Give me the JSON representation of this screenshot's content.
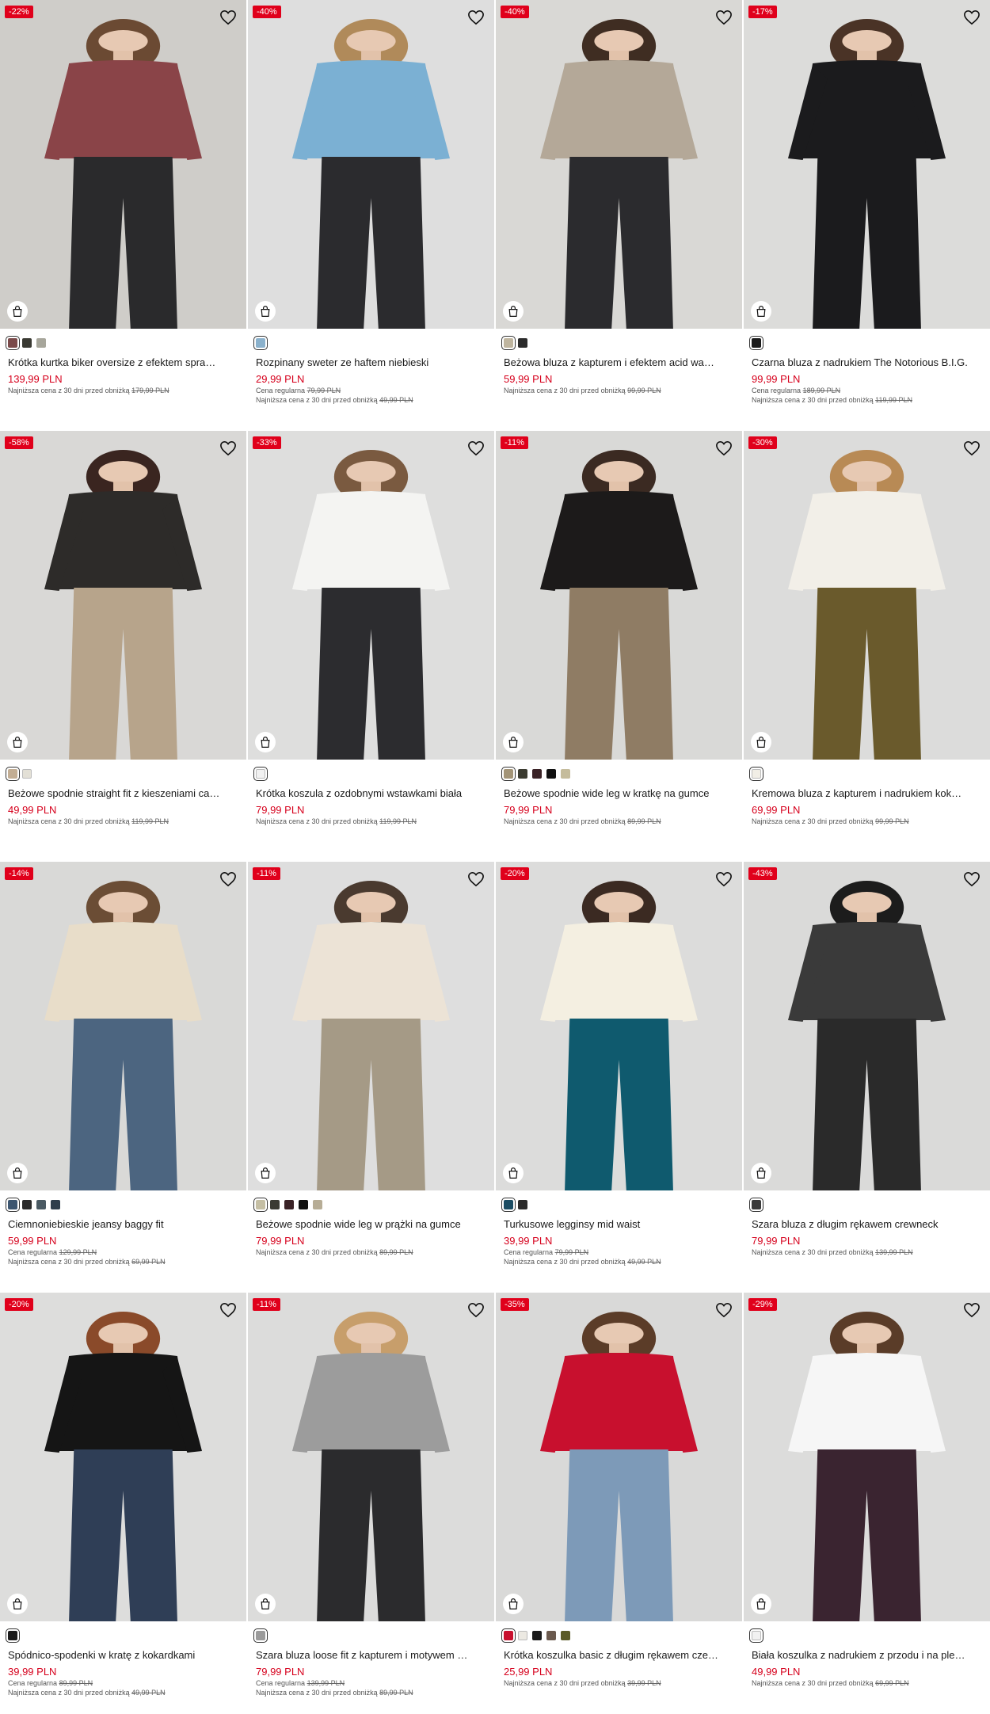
{
  "labels": {
    "lowest_prefix": "Najniższa cena z 30 dni przed obniżką",
    "regular_prefix": "Cena regularna"
  },
  "products": [
    {
      "discount": "-22%",
      "name": "Krótka kurtka biker oversize z efektem sprа…",
      "price": "139,99 PLN",
      "regular": null,
      "lowest": "179,99 PLN",
      "bg": "#cfcdc9",
      "garment": "#8a4448",
      "lower": "#2a2a2c",
      "hair": "#6b4a33",
      "swatches": [
        "#7a4a4a",
        "#3a3a33",
        "#a7a69b"
      ]
    },
    {
      "discount": "-40%",
      "name": "Rozpinany sweter ze haftem niebieski",
      "price": "29,99 PLN",
      "regular": "79,99 PLN",
      "lowest": "49,99 PLN",
      "bg": "#dedede",
      "garment": "#7bb0d3",
      "lower": "#2b2b2e",
      "hair": "#b08a5a",
      "swatches": [
        "#8ab1cc"
      ]
    },
    {
      "discount": "-40%",
      "name": "Beżowa bluza z kapturem i efektem acid wa…",
      "price": "59,99 PLN",
      "regular": null,
      "lowest": "99,99 PLN",
      "bg": "#d9d8d5",
      "garment": "#b4a898",
      "lower": "#2b2b2e",
      "hair": "#3f2d22",
      "swatches": [
        "#bfb59f",
        "#2b2b2b"
      ]
    },
    {
      "discount": "-17%",
      "name": "Czarna bluza z nadrukiem The Notorious B.I.G.",
      "price": "99,99 PLN",
      "regular": "189,99 PLN",
      "lowest": "119,99 PLN",
      "bg": "#dcdcda",
      "garment": "#1b1b1d",
      "lower": "#1b1b1d",
      "hair": "#4a3326",
      "swatches": [
        "#1a1a1a"
      ]
    },
    {
      "discount": "-58%",
      "name": "Beżowe spodnie straight fit z kieszeniami ca…",
      "price": "49,99 PLN",
      "regular": null,
      "lowest": "119,99 PLN",
      "bg": "#d9d8d6",
      "garment": "#2d2b29",
      "lower": "#b7a48b",
      "hair": "#3a2520",
      "swatches": [
        "#c2ad93",
        "#e3e0d6"
      ]
    },
    {
      "discount": "-33%",
      "name": "Krótka koszula z ozdobnymi wstawkami biała",
      "price": "79,99 PLN",
      "regular": null,
      "lowest": "119,99 PLN",
      "bg": "#dededd",
      "garment": "#f4f4f2",
      "lower": "#2c2c2f",
      "hair": "#7a5a40",
      "swatches": [
        "#f1f1f1"
      ]
    },
    {
      "discount": "-11%",
      "name": "Beżowe spodnie wide leg w kratkę na gumce",
      "price": "79,99 PLN",
      "regular": null,
      "lowest": "89,99 PLN",
      "bg": "#d9d9d7",
      "garment": "#1c1a1a",
      "lower": "#8f7c64",
      "hair": "#3b2a22",
      "swatches": [
        "#a39477",
        "#3b3b30",
        "#3a2226",
        "#111111",
        "#c5bc9c"
      ]
    },
    {
      "discount": "-30%",
      "name": "Kremowa bluza z kapturem i nadrukiem kok…",
      "price": "69,99 PLN",
      "regular": null,
      "lowest": "99,99 PLN",
      "bg": "#dcdcdb",
      "garment": "#f2efe8",
      "lower": "#6a5a2c",
      "hair": "#b88a55",
      "swatches": [
        "#f1eee6"
      ]
    },
    {
      "discount": "-14%",
      "name": "Ciemnoniebieskie jeansy baggy fit",
      "price": "59,99 PLN",
      "regular": "129,99 PLN",
      "lowest": "69,99 PLN",
      "bg": "#d9d9d7",
      "garment": "#e8ddc9",
      "lower": "#4c6580",
      "hair": "#6b4d35",
      "swatches": [
        "#3d5670",
        "#2b2b2b",
        "#4a5a63",
        "#2e3e4c"
      ]
    },
    {
      "discount": "-11%",
      "name": "Beżowe spodnie wide leg w prążki na gumce",
      "price": "79,99 PLN",
      "regular": null,
      "lowest": "89,99 PLN",
      "bg": "#dedede",
      "garment": "#ece3d6",
      "lower": "#a59a86",
      "hair": "#4a3a2f",
      "swatches": [
        "#c5bfa4",
        "#3b3b33",
        "#3a2226",
        "#111111",
        "#b7ad96"
      ]
    },
    {
      "discount": "-20%",
      "name": "Turkusowe legginsy mid waist",
      "price": "39,99 PLN",
      "regular": "79,99 PLN",
      "lowest": "49,99 PLN",
      "bg": "#dcdcdb",
      "garment": "#f4efe1",
      "lower": "#0f5a6e",
      "hair": "#3b2a22",
      "swatches": [
        "#1a4c63",
        "#2b2b2b"
      ]
    },
    {
      "discount": "-43%",
      "name": "Szara bluza z długim rękawem crewneck",
      "price": "79,99 PLN",
      "regular": null,
      "lowest": "139,99 PLN",
      "bg": "#dadad9",
      "garment": "#3a3a3a",
      "lower": "#2a2a2a",
      "hair": "#1c1c1c",
      "swatches": [
        "#3a3a3a"
      ]
    },
    {
      "discount": "-20%",
      "name": "Spódnico-spodenki w kratę z kokardkami",
      "price": "39,99 PLN",
      "regular": "89,99 PLN",
      "lowest": "49,99 PLN",
      "bg": "#dddddc",
      "garment": "#151515",
      "lower": "#2f3e56",
      "hair": "#8a4a2a",
      "swatches": [
        "#1a1a1a"
      ]
    },
    {
      "discount": "-11%",
      "name": "Szara bluza loose fit z kapturem i motywem …",
      "price": "79,99 PLN",
      "regular": "139,99 PLN",
      "lowest": "89,99 PLN",
      "bg": "#dcdcdb",
      "garment": "#9c9c9c",
      "lower": "#2b2b2d",
      "hair": "#c79e6b",
      "swatches": [
        "#9b9b9b"
      ]
    },
    {
      "discount": "-35%",
      "name": "Krótka koszulka basic z długim rękawem cze…",
      "price": "25,99 PLN",
      "regular": null,
      "lowest": "39,99 PLN",
      "bg": "#d9d9d8",
      "garment": "#c8102e",
      "lower": "#7d9ab8",
      "hair": "#5b3c28",
      "swatches": [
        "#c8102e",
        "#ece9e2",
        "#1a1a1a",
        "#6b5a4e",
        "#5a5a26"
      ]
    },
    {
      "discount": "-29%",
      "name": "Biała koszulka z nadrukiem z przodu i na ple…",
      "price": "49,99 PLN",
      "regular": null,
      "lowest": "69,99 PLN",
      "bg": "#dcdcdb",
      "garment": "#f6f6f6",
      "lower": "#3a2430",
      "hair": "#5a3c28",
      "swatches": [
        "#f1f1f1"
      ]
    }
  ]
}
